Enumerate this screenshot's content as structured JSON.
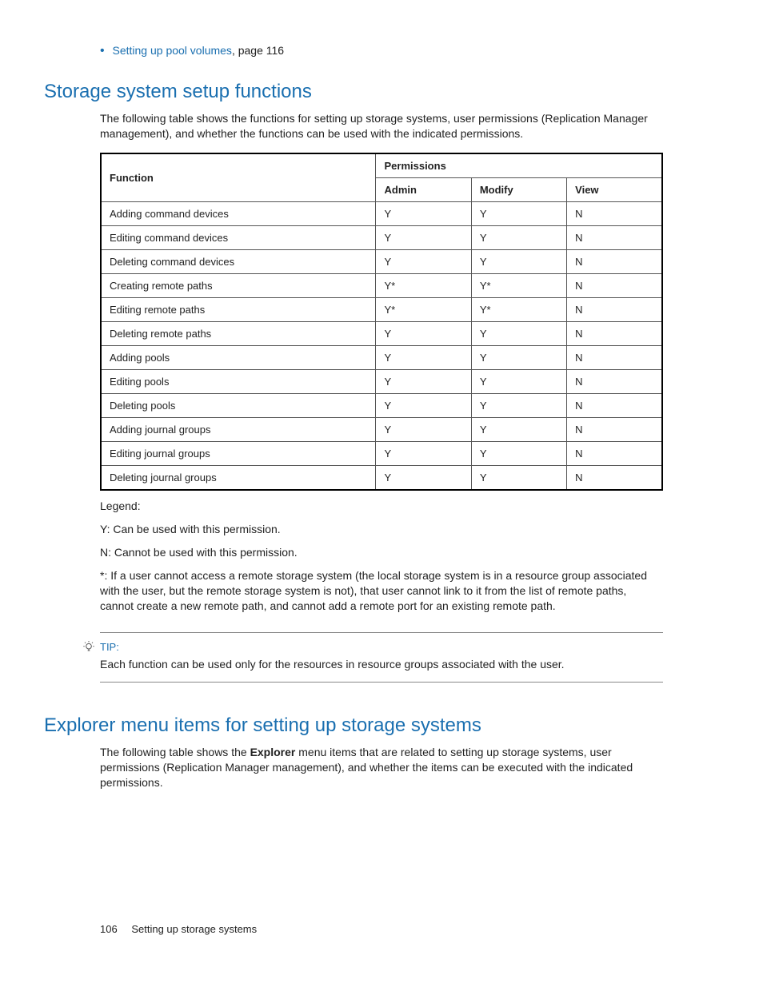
{
  "bullet": {
    "link": "Setting up pool volumes",
    "rest": ", page 116"
  },
  "section1": {
    "title": "Storage system setup functions",
    "intro": "The following table shows the functions for setting up storage systems, user permissions (Replication Manager management), and whether the functions can be used with the indicated permissions."
  },
  "table": {
    "headers": {
      "function": "Function",
      "permissions": "Permissions",
      "admin": "Admin",
      "modify": "Modify",
      "view": "View"
    },
    "rows": [
      {
        "f": "Adding command devices",
        "a": "Y",
        "m": "Y",
        "v": "N"
      },
      {
        "f": "Editing command devices",
        "a": "Y",
        "m": "Y",
        "v": "N"
      },
      {
        "f": "Deleting command devices",
        "a": "Y",
        "m": "Y",
        "v": "N"
      },
      {
        "f": "Creating remote paths",
        "a": "Y*",
        "m": "Y*",
        "v": "N"
      },
      {
        "f": "Editing remote paths",
        "a": "Y*",
        "m": "Y*",
        "v": "N"
      },
      {
        "f": "Deleting remote paths",
        "a": "Y",
        "m": "Y",
        "v": "N"
      },
      {
        "f": "Adding pools",
        "a": "Y",
        "m": "Y",
        "v": "N"
      },
      {
        "f": "Editing pools",
        "a": "Y",
        "m": "Y",
        "v": "N"
      },
      {
        "f": "Deleting pools",
        "a": "Y",
        "m": "Y",
        "v": "N"
      },
      {
        "f": "Adding journal groups",
        "a": "Y",
        "m": "Y",
        "v": "N"
      },
      {
        "f": "Editing journal groups",
        "a": "Y",
        "m": "Y",
        "v": "N"
      },
      {
        "f": "Deleting journal groups",
        "a": "Y",
        "m": "Y",
        "v": "N"
      }
    ]
  },
  "legend": {
    "title": "Legend:",
    "y": "Y: Can be used with this permission.",
    "n": "N: Cannot be used with this permission.",
    "star": "*: If a user cannot access a remote storage system (the local storage system is in a resource group associated with the user, but the remote storage system is not), that user cannot link to it from the list of remote paths, cannot create a new remote path, and cannot add a remote port for an existing remote path."
  },
  "tip": {
    "label": "TIP:",
    "text": "Each function can be used only for the resources in resource groups associated with the user."
  },
  "section2": {
    "title": "Explorer menu items for setting up storage systems",
    "intro_pre": "The following table shows the ",
    "intro_bold": "Explorer",
    "intro_post": " menu items that are related to setting up storage systems, user permissions (Replication Manager management), and whether the items can be executed with the indicated permissions."
  },
  "footer": {
    "page": "106",
    "title": "Setting up storage systems"
  }
}
